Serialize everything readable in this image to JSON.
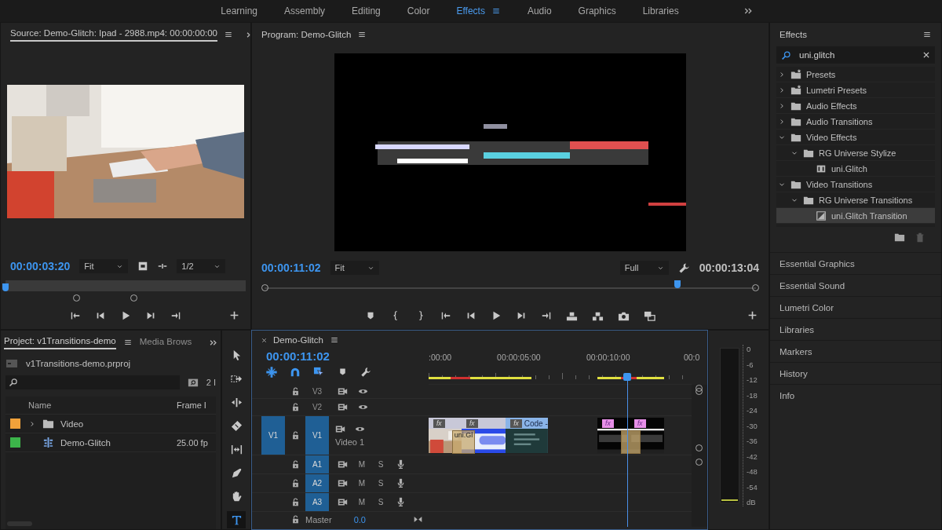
{
  "workspaces": [
    {
      "label": "Learning",
      "selected": false
    },
    {
      "label": "Assembly",
      "selected": false
    },
    {
      "label": "Editing",
      "selected": false
    },
    {
      "label": "Color",
      "selected": false
    },
    {
      "label": "Effects",
      "selected": true
    },
    {
      "label": "Audio",
      "selected": false
    },
    {
      "label": "Graphics",
      "selected": false
    },
    {
      "label": "Libraries",
      "selected": false
    }
  ],
  "source": {
    "title": "Source: Demo-Glitch: Ipad - 2988.mp4: 00:00:00:00",
    "timecode": "00:00:03:20",
    "zoom": "Fit",
    "resolution": "1/2",
    "level": 0.0
  },
  "program": {
    "title": "Program: Demo-Glitch",
    "timecode": "00:00:11:02",
    "zoom": "Fit",
    "quality": "Full",
    "duration": "00:00:13:04",
    "level": 0.84
  },
  "effects": {
    "title": "Effects",
    "search": "uni.glitch",
    "tree": [
      {
        "label": "Presets",
        "kind": "preset-folder",
        "expanded": false,
        "selected": false
      },
      {
        "label": "Lumetri Presets",
        "kind": "preset-folder",
        "expanded": false,
        "selected": false
      },
      {
        "label": "Audio Effects",
        "kind": "folder",
        "expanded": false,
        "selected": false
      },
      {
        "label": "Audio Transitions",
        "kind": "folder",
        "expanded": false,
        "selected": false
      },
      {
        "label": "Video Effects",
        "kind": "folder",
        "expanded": true,
        "selected": false,
        "children": [
          {
            "label": "RG Universe Stylize",
            "kind": "folder",
            "expanded": true,
            "selected": false,
            "children": [
              {
                "label": "uni.Glitch",
                "kind": "effect",
                "selected": false
              }
            ]
          }
        ]
      },
      {
        "label": "Video Transitions",
        "kind": "folder",
        "expanded": true,
        "selected": false,
        "children": [
          {
            "label": "RG Universe Transitions",
            "kind": "folder",
            "expanded": true,
            "selected": false,
            "children": [
              {
                "label": "uni.Glitch Transition",
                "kind": "transition",
                "selected": true
              }
            ]
          }
        ]
      }
    ]
  },
  "panels": [
    "Essential Graphics",
    "Essential Sound",
    "Lumetri Color",
    "Libraries",
    "Markers",
    "History",
    "Info"
  ],
  "project": {
    "tabs": [
      {
        "label": "Project: v1Transitions-demo",
        "selected": true
      },
      {
        "label": "Media Brows",
        "selected": false
      }
    ],
    "file": "v1Transitions-demo.prproj",
    "count": "2 I",
    "columns": [
      "Name",
      "Frame I"
    ],
    "rows": [
      {
        "name": "Video",
        "kind": "folder",
        "color": "#f2a23a",
        "expanded": false
      },
      {
        "name": "Demo-Glitch",
        "kind": "sequence",
        "color": "#3cb54a",
        "frame_rate": "25.00 fp"
      }
    ]
  },
  "tools": [
    {
      "kind": "select",
      "selected": false
    },
    {
      "kind": "track-select",
      "selected": false
    },
    {
      "kind": "ripple",
      "selected": false
    },
    {
      "kind": "razor",
      "selected": false
    },
    {
      "kind": "slip",
      "selected": false
    },
    {
      "kind": "pen",
      "selected": false
    },
    {
      "kind": "hand",
      "selected": false
    },
    {
      "kind": "type",
      "selected": true
    }
  ],
  "timeline": {
    "title": "Demo-Glitch",
    "timecode": "00:00:11:02",
    "ruler": [
      ":00:00",
      "00:00:05:00",
      "00:00:10:00",
      "00:0"
    ],
    "level": 0.755,
    "video_tracks": [
      {
        "name": "V3",
        "targeted": false
      },
      {
        "name": "V2",
        "targeted": false
      },
      {
        "name": "V1",
        "targeted": true,
        "source": "V1",
        "label": "Video 1"
      }
    ],
    "audio_tracks": [
      {
        "name": "A1",
        "targeted": true,
        "mute": "M",
        "solo": "S"
      },
      {
        "name": "A2",
        "targeted": true,
        "mute": "M",
        "solo": "S"
      },
      {
        "name": "A3",
        "targeted": true,
        "mute": "M",
        "solo": "S"
      }
    ],
    "master": {
      "label": "Master",
      "value": "0.0"
    },
    "clips": [
      {
        "badge": "fx"
      },
      {
        "kind": "screen",
        "badge": "fx"
      },
      {
        "kind": "code",
        "badge": "fx",
        "label": "Code -"
      },
      {
        "kind": "title",
        "badge": "fx"
      },
      {
        "kind": "title",
        "badge": "fx"
      }
    ],
    "transitions": [
      {
        "kind": "cross-dissolve",
        "label": "uni.Gl"
      },
      {
        "kind": "cross-dissolve"
      }
    ]
  },
  "meter": {
    "scale": [
      "0",
      "-6",
      "-12",
      "-18",
      "-24",
      "-30",
      "-36",
      "-42",
      "-48",
      "-54",
      "dB"
    ]
  }
}
